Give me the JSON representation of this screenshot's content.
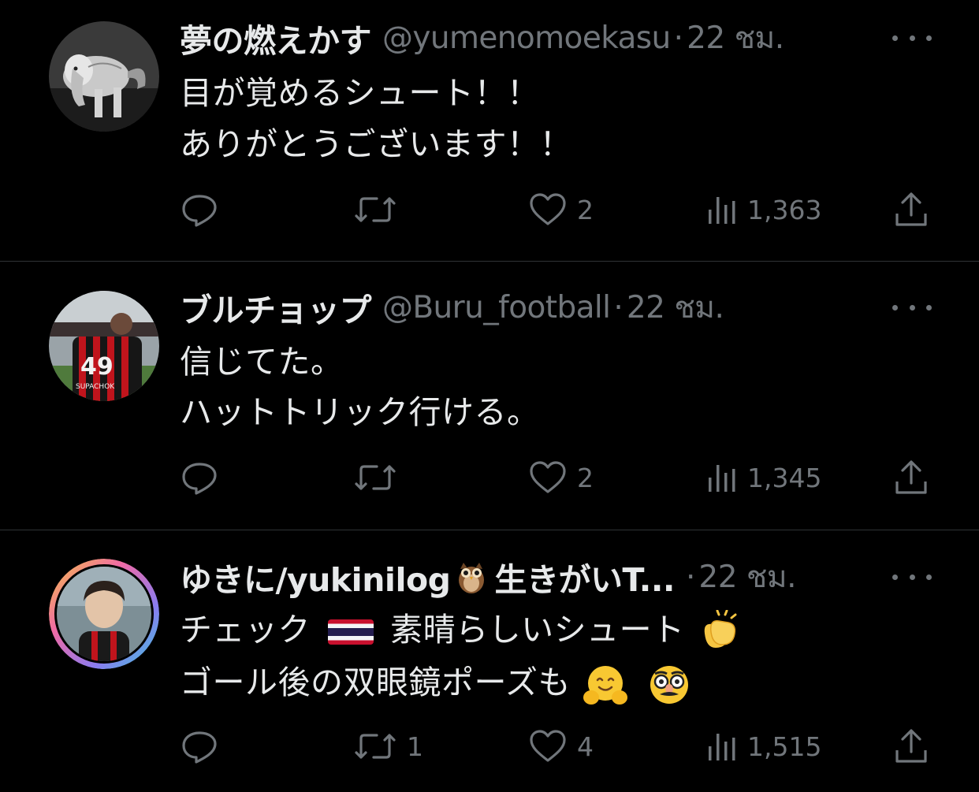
{
  "tweets": [
    {
      "name": "夢の燃えかす",
      "handle": "@yumenomoekasu",
      "dot": "·",
      "time": "22 ชม.",
      "lines": [
        "目が覚めるシュート！！",
        "ありがとうございます！！"
      ],
      "avatar_icon": "dog-drawing-avatar",
      "stats": {
        "reply": "",
        "retweet": "",
        "like": "2",
        "views": "1,363"
      }
    },
    {
      "name": "ブルチョップ",
      "handle": "@Buru_football",
      "dot": "·",
      "time": "22 ชม.",
      "lines": [
        "信じてた。",
        "ハットトリック行ける。"
      ],
      "avatar_icon": "football-jersey-49-avatar",
      "stats": {
        "reply": "",
        "retweet": "",
        "like": "2",
        "views": "1,345"
      }
    },
    {
      "name_part1": "ゆきに/yukinilog",
      "name_emoji": "owl-emoji",
      "name_part2": "生きがいT...",
      "dot": "·",
      "time": "22 ชม.",
      "line1_part1": "チェック",
      "line1_flag": "thailand-flag-emoji",
      "line1_part2": "素晴らしいシュート",
      "line1_emoji": "clapping-hands-emoji",
      "line2": "ゴール後の双眼鏡ポーズも",
      "line2_emojis": [
        "hugging-face-emoji",
        "disguised-face-emoji"
      ],
      "avatar_icon": "person-photo-avatar-gradient-ring",
      "stats": {
        "reply": "",
        "retweet": "1",
        "like": "4",
        "views": "1,515"
      }
    }
  ],
  "colors": {
    "background": "#000000",
    "text_primary": "#e7e9ea",
    "text_secondary": "#71767b",
    "divider": "#2f3336"
  }
}
